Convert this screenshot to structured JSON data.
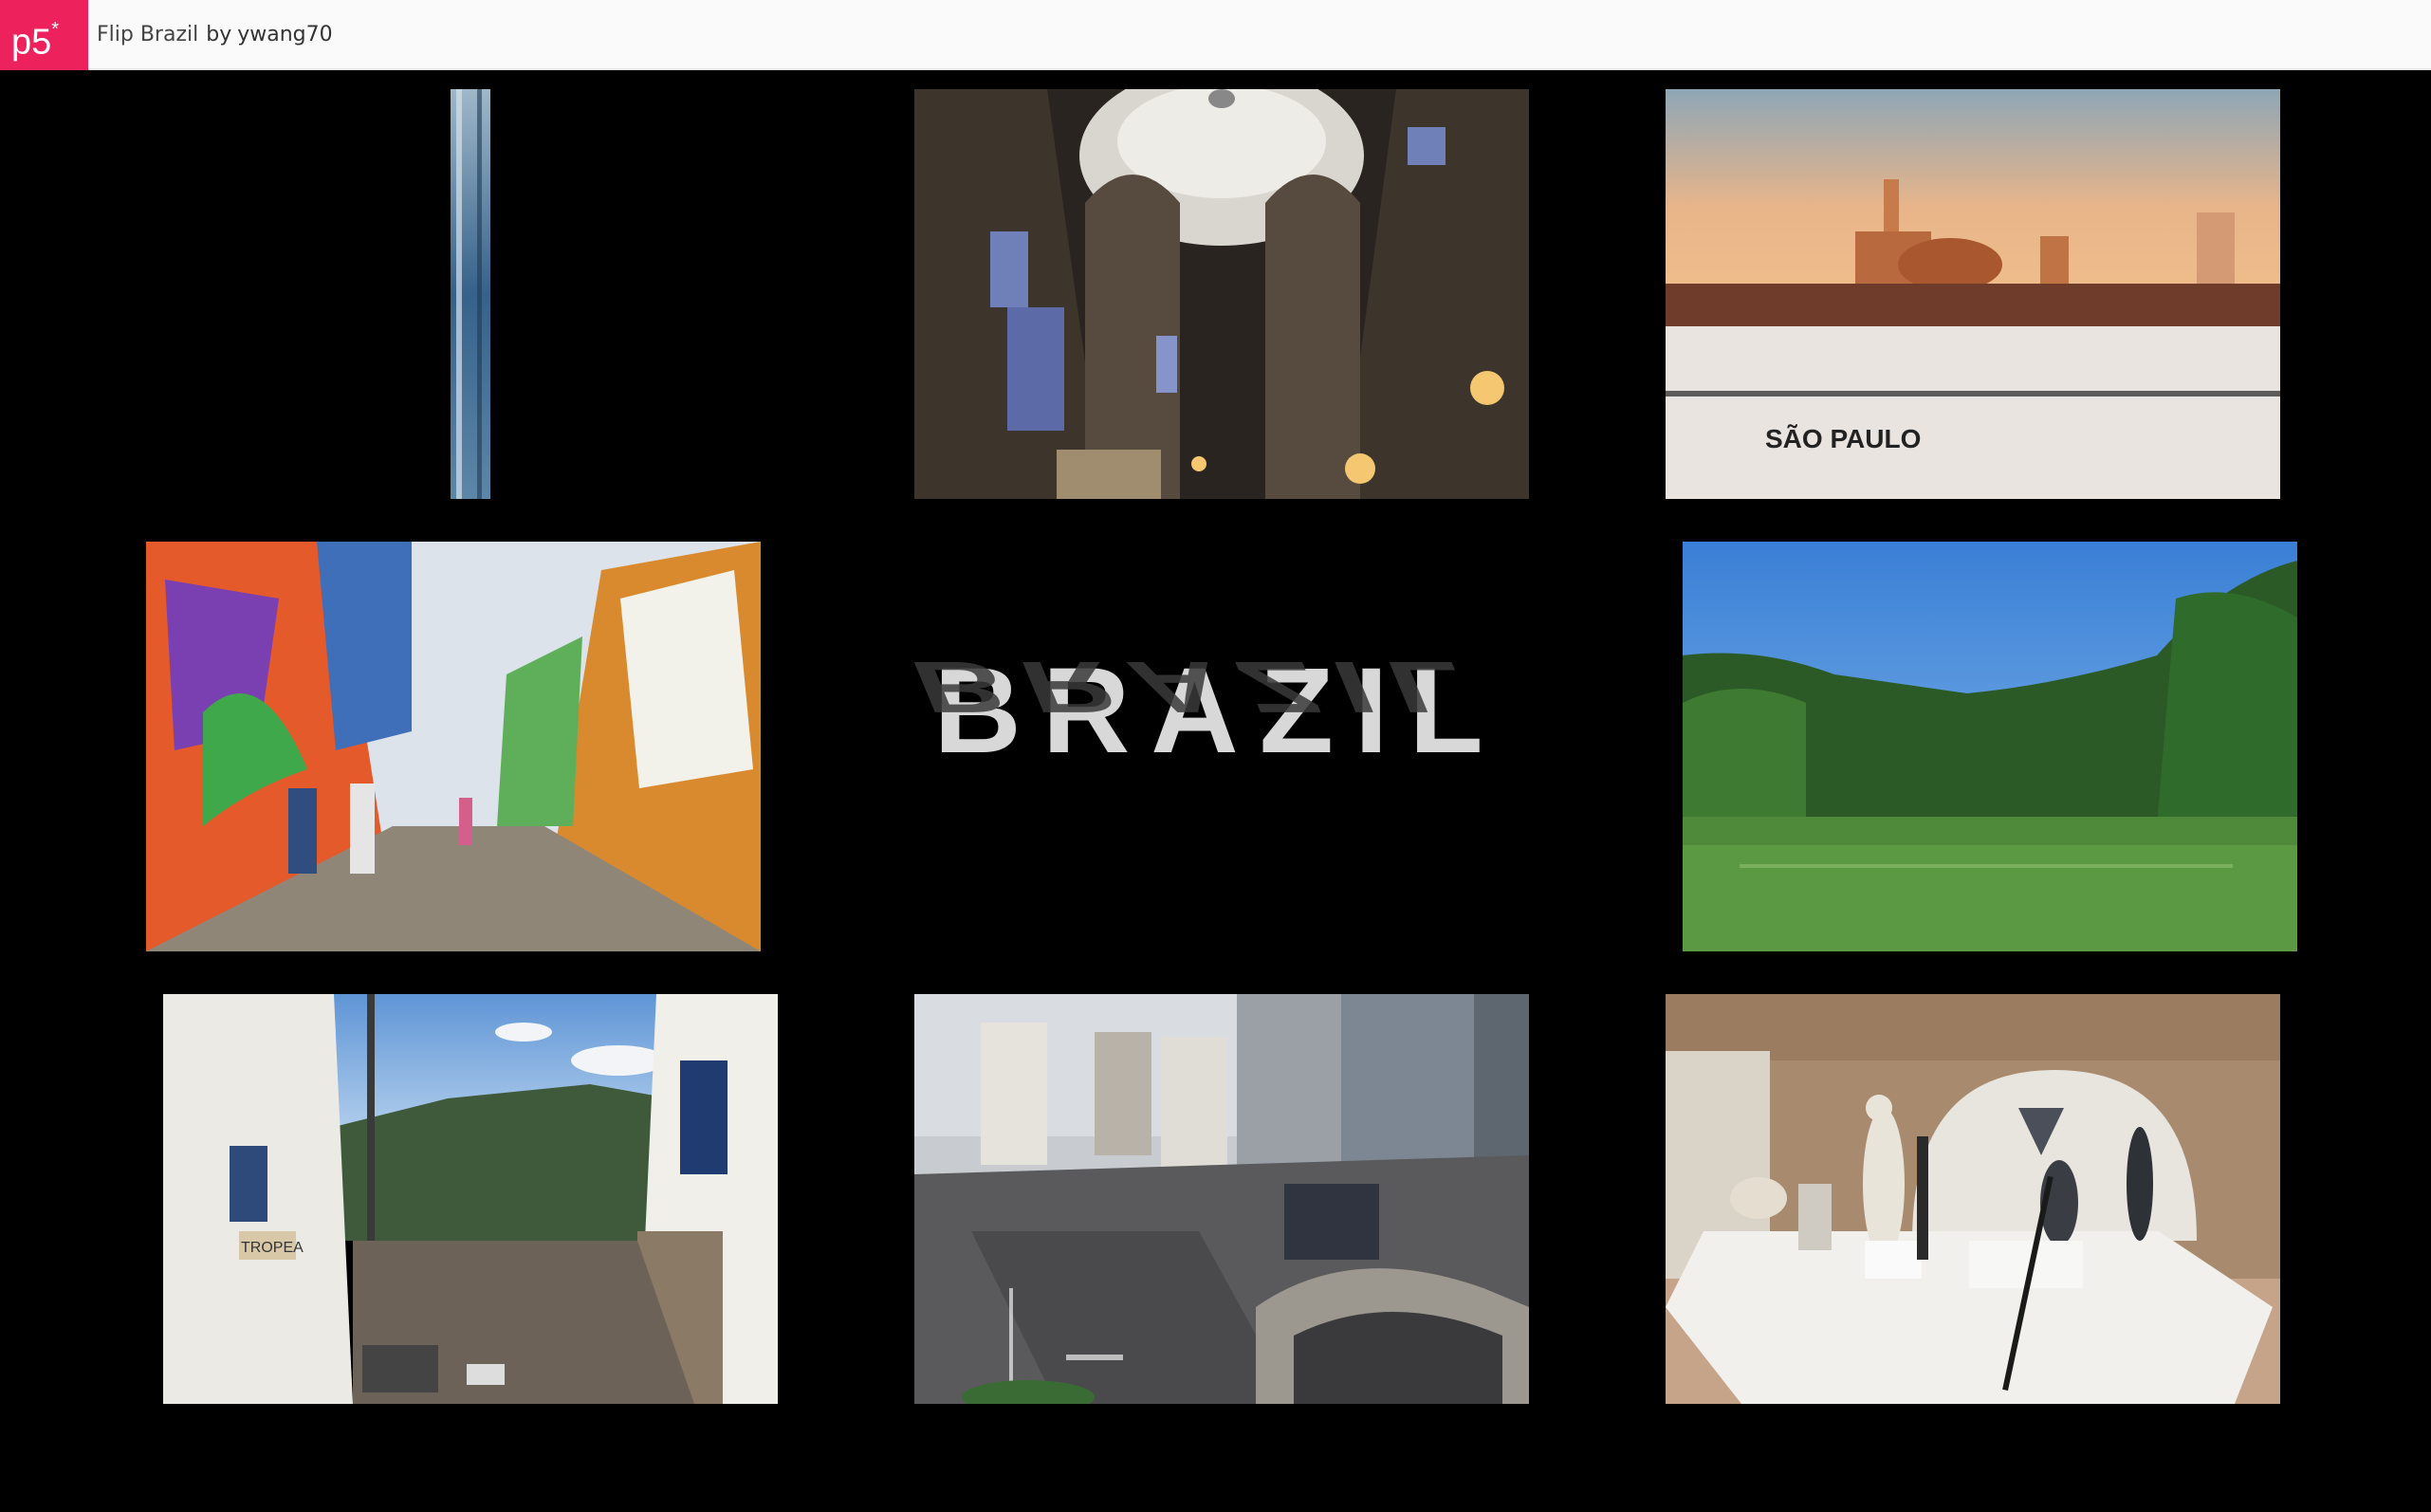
{
  "header": {
    "logo_text": "p5",
    "logo_mark": "*",
    "sketch_title": "Flip Brazil",
    "by_label": "by",
    "author": "ywang70",
    "brand_color": "#ed225d"
  },
  "canvas": {
    "background": "#000000",
    "center_title": "BRAZIL",
    "center_title_reflection": "BRAZIL",
    "photos": [
      {
        "name": "flipping-photo",
        "subject": "partially flipped photo (edge-on)"
      },
      {
        "name": "cathedral-interior-photo",
        "subject": "cathedral dome interior"
      },
      {
        "name": "sao-paulo-skyline-photo",
        "subject": "Sao Paulo skyline at sunset",
        "caption": "SÃO PAULO"
      },
      {
        "name": "graffiti-alley-photo",
        "subject": "colorful graffiti alley"
      },
      {
        "name": "tropical-lake-photo",
        "subject": "lake with palm trees"
      },
      {
        "name": "colonial-street-photo",
        "subject": "colonial hillside street",
        "sign": "TROPEA"
      },
      {
        "name": "city-avenue-photo",
        "subject": "city avenue and skyscrapers"
      },
      {
        "name": "sculpture-gallery-photo",
        "subject": "sculpture gallery"
      }
    ]
  }
}
